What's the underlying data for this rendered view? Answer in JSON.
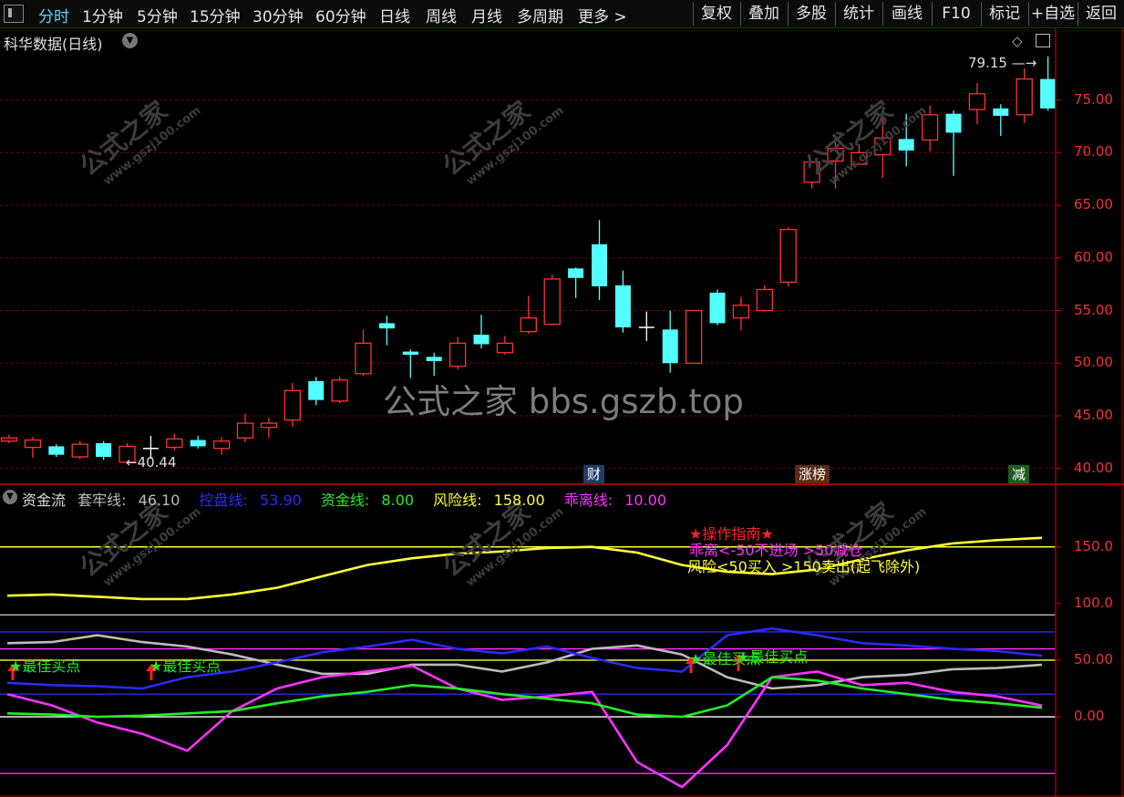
{
  "toolbar": {
    "periods": [
      "分时",
      "1分钟",
      "5分钟",
      "15分钟",
      "30分钟",
      "60分钟",
      "日线",
      "周线",
      "月线",
      "多周期",
      "更多 >"
    ],
    "tools": [
      "复权",
      "叠加",
      "多股",
      "统计",
      "画线",
      "F10",
      "标记",
      "+自选",
      "返回"
    ]
  },
  "stock_title": "科华数据(日线)",
  "price_labels": {
    "high": "79.15",
    "low": "40.44"
  },
  "y_axis_main": [
    "75.00",
    "70.00",
    "65.00",
    "60.00",
    "55.00",
    "50.00",
    "45.00",
    "40.00"
  ],
  "y_axis_ind": [
    "150.0",
    "100.0",
    "50.00",
    "0.00"
  ],
  "watermark": "公式之家 bbs.gszb.top",
  "small_watermark": {
    "cn": "公式之家",
    "url": "www.gszj100.com"
  },
  "badges": {
    "cai": "财",
    "zhangbang": "涨榜",
    "jian": "减"
  },
  "indicator": {
    "name": "资金流",
    "items": [
      {
        "label": "套牢线:",
        "value": "46.10",
        "color": "#bbbbbb"
      },
      {
        "label": "控盘线:",
        "value": "53.90",
        "color": "#2a2aff"
      },
      {
        "label": "资金线:",
        "value": "8.00",
        "color": "#22ee22"
      },
      {
        "label": "风险线:",
        "value": "158.00",
        "color": "#ffff33"
      },
      {
        "label": "乖离线:",
        "value": "10.00",
        "color": "#ff33ff"
      }
    ]
  },
  "annotations": {
    "guide_title": "★操作指南★",
    "guide_line1": "乖离<-50不进场 >50减仓",
    "guide_line2": "风险<50买入 >150卖出(起飞除外)",
    "best_buy": "★最佳买点"
  },
  "chart_data": [
    {
      "type": "candlestick",
      "title": "科华数据(日线)",
      "ylim": [
        38.5,
        80
      ],
      "candles": [
        {
          "o": 42.6,
          "c": 42.9,
          "h": 43.2,
          "l": 42.4
        },
        {
          "o": 42.0,
          "c": 42.7,
          "h": 43.0,
          "l": 41.0
        },
        {
          "o": 42.1,
          "c": 41.3,
          "h": 42.3,
          "l": 41.1
        },
        {
          "o": 41.1,
          "c": 42.3,
          "h": 42.6,
          "l": 40.9
        },
        {
          "o": 42.4,
          "c": 41.1,
          "h": 42.6,
          "l": 40.8
        },
        {
          "o": 40.6,
          "c": 42.1,
          "h": 42.4,
          "l": 40.44
        },
        {
          "o": 41.9,
          "c": 41.9,
          "h": 43.1,
          "l": 40.9
        },
        {
          "o": 42.0,
          "c": 42.8,
          "h": 43.3,
          "l": 41.7
        },
        {
          "o": 42.7,
          "c": 42.1,
          "h": 43.1,
          "l": 41.9
        },
        {
          "o": 41.9,
          "c": 42.6,
          "h": 43.0,
          "l": 41.3
        },
        {
          "o": 42.9,
          "c": 44.3,
          "h": 45.2,
          "l": 42.5
        },
        {
          "o": 43.9,
          "c": 44.3,
          "h": 44.8,
          "l": 42.9
        },
        {
          "o": 44.6,
          "c": 47.4,
          "h": 48.1,
          "l": 44.0
        },
        {
          "o": 48.3,
          "c": 46.5,
          "h": 48.7,
          "l": 46.0
        },
        {
          "o": 46.4,
          "c": 48.4,
          "h": 48.7,
          "l": 46.2
        },
        {
          "o": 49.0,
          "c": 51.9,
          "h": 53.2,
          "l": 48.8
        },
        {
          "o": 53.8,
          "c": 53.3,
          "h": 54.5,
          "l": 51.7
        },
        {
          "o": 51.1,
          "c": 50.8,
          "h": 51.3,
          "l": 48.6
        },
        {
          "o": 50.6,
          "c": 50.2,
          "h": 51.0,
          "l": 48.8
        },
        {
          "o": 49.7,
          "c": 51.9,
          "h": 52.5,
          "l": 49.4
        },
        {
          "o": 52.7,
          "c": 51.8,
          "h": 54.6,
          "l": 51.4
        },
        {
          "o": 51.0,
          "c": 51.9,
          "h": 52.6,
          "l": 50.8
        },
        {
          "o": 53.0,
          "c": 54.3,
          "h": 56.4,
          "l": 52.8
        },
        {
          "o": 53.7,
          "c": 58.0,
          "h": 58.4,
          "l": 53.6
        },
        {
          "o": 59.0,
          "c": 58.1,
          "h": 59.1,
          "l": 56.2
        },
        {
          "o": 61.3,
          "c": 57.3,
          "h": 63.6,
          "l": 56.0
        },
        {
          "o": 57.4,
          "c": 53.4,
          "h": 58.8,
          "l": 52.9
        },
        {
          "o": 53.4,
          "c": 53.4,
          "h": 54.9,
          "l": 52.1
        },
        {
          "o": 53.2,
          "c": 50.0,
          "h": 55.0,
          "l": 49.1
        },
        {
          "o": 50.0,
          "c": 55.0,
          "h": 55.0,
          "l": 50.0
        },
        {
          "o": 56.7,
          "c": 53.8,
          "h": 57.0,
          "l": 53.6
        },
        {
          "o": 54.3,
          "c": 55.5,
          "h": 56.3,
          "l": 53.1
        },
        {
          "o": 55.0,
          "c": 57.0,
          "h": 57.4,
          "l": 54.9
        },
        {
          "o": 57.7,
          "c": 62.7,
          "h": 62.9,
          "l": 57.3
        },
        {
          "o": 67.2,
          "c": 69.1,
          "h": 69.2,
          "l": 66.6
        },
        {
          "o": 69.2,
          "c": 70.4,
          "h": 71.0,
          "l": 66.6
        },
        {
          "o": 68.9,
          "c": 70.0,
          "h": 70.8,
          "l": 68.9
        },
        {
          "o": 69.8,
          "c": 71.4,
          "h": 73.3,
          "l": 67.6
        },
        {
          "o": 71.3,
          "c": 70.2,
          "h": 73.7,
          "l": 68.7
        },
        {
          "o": 71.2,
          "c": 73.6,
          "h": 74.5,
          "l": 70.1
        },
        {
          "o": 73.7,
          "c": 71.9,
          "h": 74.0,
          "l": 67.8
        },
        {
          "o": 74.1,
          "c": 75.6,
          "h": 76.6,
          "l": 72.7
        },
        {
          "o": 74.2,
          "c": 73.5,
          "h": 74.6,
          "l": 71.6
        },
        {
          "o": 73.6,
          "c": 77.0,
          "h": 78.0,
          "l": 72.8
        },
        {
          "o": 77.0,
          "c": 74.2,
          "h": 79.15,
          "l": 74.0
        }
      ]
    },
    {
      "type": "line",
      "title": "资金流",
      "ylim": [
        -70,
        182
      ],
      "hlines": [
        {
          "y": 150,
          "color": "#ffff33"
        },
        {
          "y": 90,
          "color": "#bbbbbb"
        },
        {
          "y": 75,
          "color": "#2a2aff"
        },
        {
          "y": 60,
          "color": "#ff33ff"
        },
        {
          "y": 50,
          "color": "#ffff33"
        },
        {
          "y": 20,
          "color": "#2a2aff"
        },
        {
          "y": 0,
          "color": "#ffffff"
        },
        {
          "y": -50,
          "color": "#ff33ff"
        }
      ],
      "series": [
        {
          "name": "风险线",
          "color": "#ffff33",
          "values": [
            107,
            108,
            106,
            104,
            104,
            108,
            114,
            124,
            134,
            140,
            144,
            146,
            149,
            150,
            145,
            134,
            128,
            126,
            130,
            139,
            147,
            153,
            156,
            158
          ]
        },
        {
          "name": "控盘线",
          "color": "#2a2aff",
          "values": [
            30,
            28,
            27,
            25,
            35,
            40,
            48,
            57,
            62,
            68,
            60,
            56,
            62,
            52,
            43,
            40,
            72,
            78,
            72,
            65,
            63,
            60,
            58,
            54
          ]
        },
        {
          "name": "套牢线",
          "color": "#bbbbbb",
          "values": [
            65,
            66,
            72,
            66,
            62,
            55,
            46,
            38,
            38,
            46,
            46,
            40,
            48,
            60,
            63,
            55,
            35,
            25,
            28,
            35,
            37,
            42,
            43,
            46
          ]
        },
        {
          "name": "资金线",
          "color": "#22ee22",
          "values": [
            3,
            2,
            0,
            1,
            3,
            5,
            12,
            18,
            22,
            28,
            25,
            20,
            16,
            12,
            2,
            0,
            10,
            35,
            32,
            25,
            20,
            15,
            12,
            8
          ]
        },
        {
          "name": "乖离线",
          "color": "#ff33ff",
          "values": [
            20,
            10,
            -5,
            -15,
            -30,
            5,
            25,
            35,
            40,
            45,
            25,
            15,
            18,
            22,
            -40,
            -62,
            -25,
            35,
            40,
            28,
            30,
            22,
            18,
            10
          ]
        }
      ]
    }
  ]
}
